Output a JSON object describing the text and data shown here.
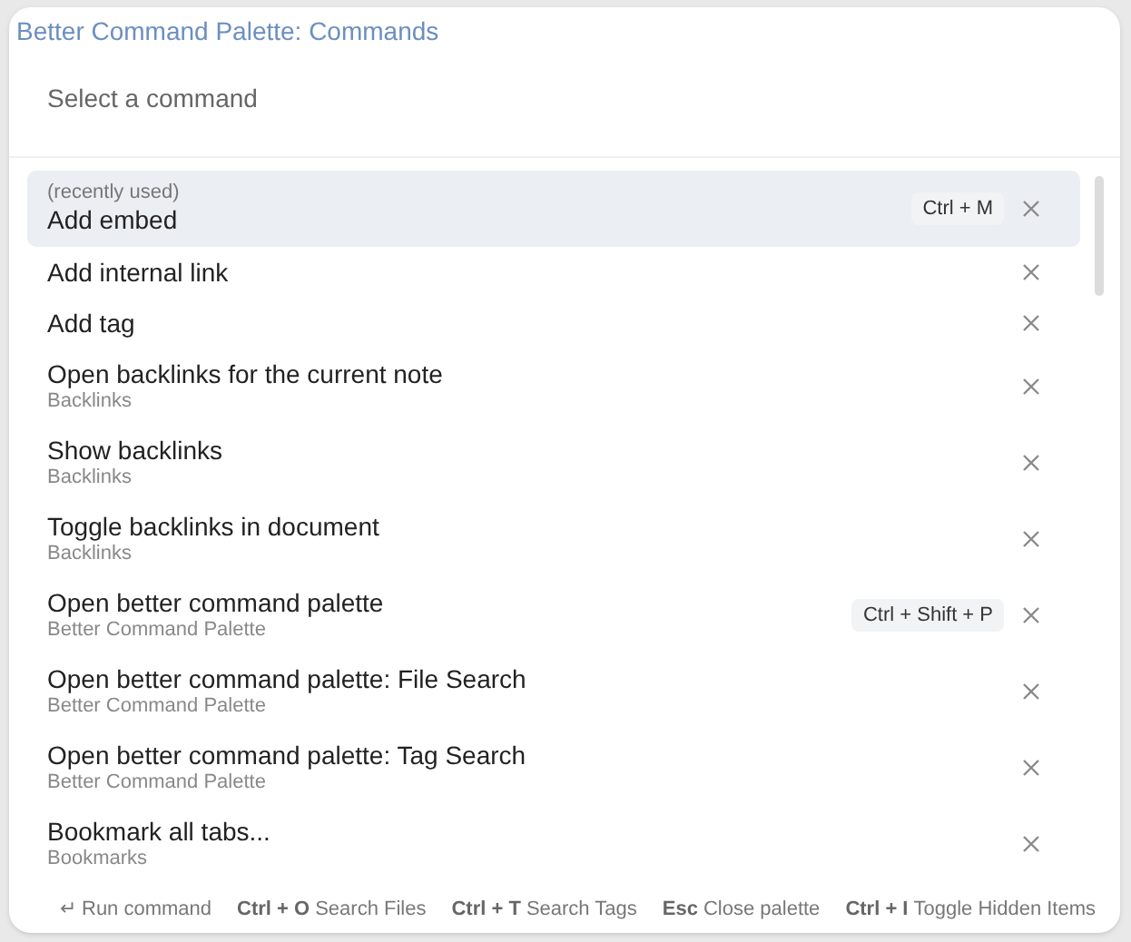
{
  "window": {
    "title": "Better Command Palette: Commands"
  },
  "search": {
    "placeholder": "Select a command"
  },
  "commands": [
    {
      "note": "(recently used)",
      "name": "Add embed",
      "hotkey": "Ctrl + M",
      "selected": true
    },
    {
      "name": "Add internal link",
      "selected": false
    },
    {
      "name": "Add tag",
      "selected": false
    },
    {
      "name": "Open backlinks for the current note",
      "plugin": "Backlinks",
      "selected": false
    },
    {
      "name": "Show backlinks",
      "plugin": "Backlinks",
      "selected": false
    },
    {
      "name": "Toggle backlinks in document",
      "plugin": "Backlinks",
      "selected": false
    },
    {
      "name": "Open better command palette",
      "plugin": "Better Command Palette",
      "hotkey": "Ctrl + Shift + P",
      "selected": false
    },
    {
      "name": "Open better command palette: File Search",
      "plugin": "Better Command Palette",
      "selected": false
    },
    {
      "name": "Open better command palette: Tag Search",
      "plugin": "Better Command Palette",
      "selected": false
    },
    {
      "name": "Bookmark all tabs...",
      "plugin": "Bookmarks",
      "selected": false
    }
  ],
  "footer": [
    {
      "key": "↵",
      "label": "Run command",
      "kind": "glyph"
    },
    {
      "key": "Ctrl + O",
      "label": "Search Files",
      "kind": "bold"
    },
    {
      "key": "Ctrl + T",
      "label": "Search Tags",
      "kind": "bold"
    },
    {
      "key": "Esc",
      "label": "Close palette",
      "kind": "bold"
    },
    {
      "key": "Ctrl + I",
      "label": "Toggle Hidden Items",
      "kind": "bold"
    }
  ]
}
